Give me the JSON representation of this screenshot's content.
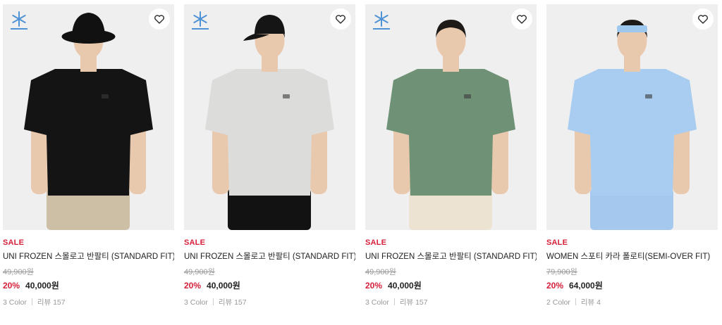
{
  "products": [
    {
      "badge_icon": "snowflake-icon",
      "sale_label": "SALE",
      "name": "UNI FROZEN 스몰로고 반팔티 (STANDARD FIT)",
      "original_price": "49,900원",
      "discount": "20%",
      "price": "40,000원",
      "colors": "3 Color",
      "reviews": "리뷰 157",
      "shirt_color": "#141414",
      "bottom_color": "#cdbfa6",
      "hat": "bucket",
      "hat_color": "#111111"
    },
    {
      "badge_icon": "snowflake-icon",
      "sale_label": "SALE",
      "name": "UNI FROZEN 스몰로고 반팔티 (STANDARD FIT)",
      "original_price": "49,900원",
      "discount": "20%",
      "price": "40,000원",
      "colors": "3 Color",
      "reviews": "리뷰 157",
      "shirt_color": "#dcdcda",
      "bottom_color": "#121212",
      "hat": "cap",
      "hat_color": "#151515"
    },
    {
      "badge_icon": "snowflake-icon",
      "sale_label": "SALE",
      "name": "UNI FROZEN 스몰로고 반팔티 (STANDARD FIT)",
      "original_price": "49,900원",
      "discount": "20%",
      "price": "40,000원",
      "colors": "3 Color",
      "reviews": "리뷰 157",
      "shirt_color": "#6f9276",
      "bottom_color": "#ece3d3",
      "hat": "none",
      "hat_color": ""
    },
    {
      "badge_icon": "",
      "sale_label": "SALE",
      "name": "WOMEN 스포티 카라 폴로티(SEMI-OVER FIT)",
      "original_price": "79,900원",
      "discount": "20%",
      "price": "64,000원",
      "colors": "2 Color",
      "reviews": "리뷰 4",
      "shirt_color": "#a9cdf0",
      "bottom_color": "#a4c8ee",
      "hat": "headband",
      "hat_color": "#9ec7ee"
    }
  ],
  "colors": {
    "sale": "#d6203a",
    "badge": "#4f93d6",
    "muted": "#999999",
    "image_bg": "#efefef"
  },
  "icons": {
    "wishlist": "heart-outline-icon",
    "badge": "snowflake-icon"
  }
}
